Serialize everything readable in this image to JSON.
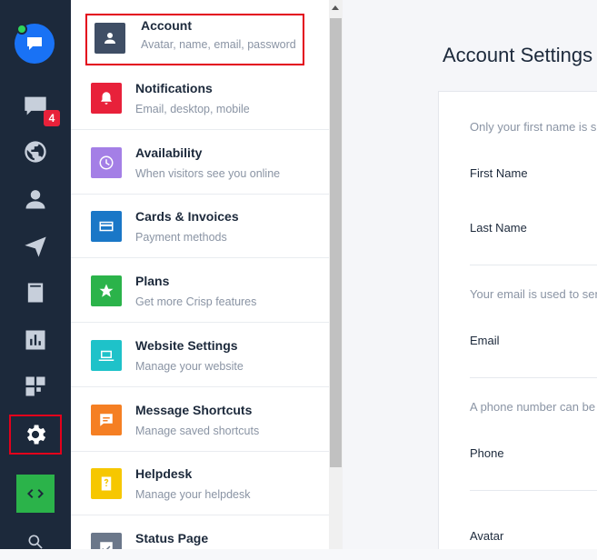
{
  "rail": {
    "badge_count": "4",
    "icons": [
      "chat-icon",
      "globe-icon",
      "user-icon",
      "send-icon",
      "book-icon",
      "stats-icon",
      "plugins-icon",
      "gear-icon",
      "code-icon",
      "search-icon"
    ]
  },
  "menu": {
    "items": [
      {
        "title": "Account",
        "subtitle": "Avatar, name, email, password",
        "color": "#3f4e65",
        "icon": "user-icon"
      },
      {
        "title": "Notifications",
        "subtitle": "Email, desktop, mobile",
        "color": "#e8213a",
        "icon": "bell-icon"
      },
      {
        "title": "Availability",
        "subtitle": "When visitors see you online",
        "color": "#a47fe6",
        "icon": "clock-icon"
      },
      {
        "title": "Cards & Invoices",
        "subtitle": "Payment methods",
        "color": "#1a77c7",
        "icon": "card-icon"
      },
      {
        "title": "Plans",
        "subtitle": "Get more Crisp features",
        "color": "#2bb34a",
        "icon": "star-icon"
      },
      {
        "title": "Website Settings",
        "subtitle": "Manage your website",
        "color": "#1ec2c9",
        "icon": "laptop-icon"
      },
      {
        "title": "Message Shortcuts",
        "subtitle": "Manage saved shortcuts",
        "color": "#f57f23",
        "icon": "message-icon"
      },
      {
        "title": "Helpdesk",
        "subtitle": "Manage your helpdesk",
        "color": "#f6c700",
        "icon": "helpdesk-icon"
      },
      {
        "title": "Status Page",
        "subtitle": "",
        "color": "#6b778a",
        "icon": "check-icon"
      }
    ]
  },
  "main": {
    "title": "Account Settings",
    "hint_name": "Only your first name is s",
    "label_first_name": "First Name",
    "label_last_name": "Last Name",
    "hint_email": "Your email is used to sen",
    "label_email": "Email",
    "hint_phone": "A phone number can be",
    "label_phone": "Phone",
    "label_avatar": "Avatar"
  }
}
